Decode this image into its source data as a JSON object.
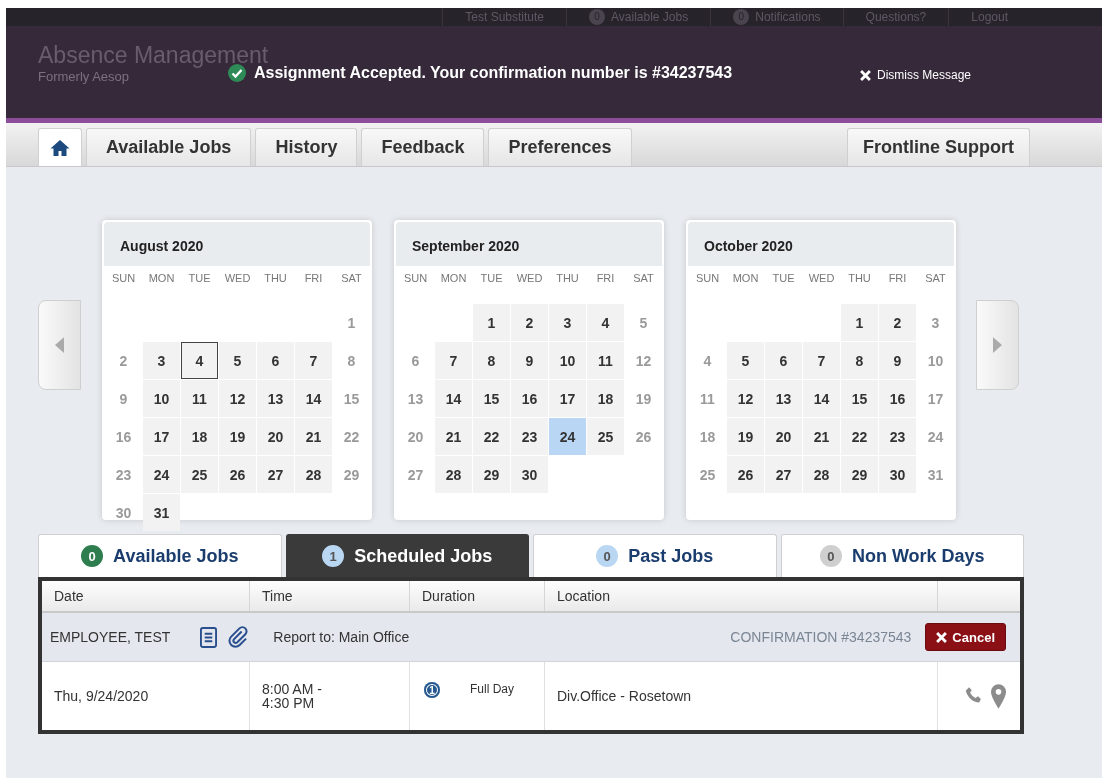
{
  "top_bar": {
    "user": "Test Substitute",
    "items": [
      {
        "count": "0",
        "label": "Available Jobs"
      },
      {
        "count": "0",
        "label": "Notifications"
      },
      {
        "label": "Questions?"
      },
      {
        "label": "Logout"
      }
    ]
  },
  "brand": {
    "title": "Absence Management",
    "subtitle": "Formerly Aesop"
  },
  "message": {
    "text": "Assignment Accepted. Your confirmation number is #34237543",
    "dismiss": "Dismiss Message"
  },
  "nav_tabs": [
    {
      "kind": "home",
      "selected": true
    },
    {
      "kind": "text",
      "label": "Available Jobs",
      "selected": false
    },
    {
      "kind": "text",
      "label": "History",
      "selected": false
    },
    {
      "kind": "text",
      "label": "Feedback",
      "selected": false
    },
    {
      "kind": "text",
      "label": "Preferences",
      "selected": false
    }
  ],
  "support_tab": {
    "label": "Frontline Support"
  },
  "calendars": [
    {
      "title": "August 2020",
      "weekdays": [
        "SUN",
        "MON",
        "TUE",
        "WED",
        "THU",
        "FRI",
        "SAT"
      ],
      "days": [
        {
          "kind": "blank"
        },
        {
          "kind": "blank"
        },
        {
          "kind": "blank"
        },
        {
          "kind": "blank"
        },
        {
          "kind": "blank"
        },
        {
          "kind": "blank"
        },
        {
          "d": "1",
          "kind": "off"
        },
        {
          "d": "2",
          "kind": "off"
        },
        {
          "d": "3",
          "kind": "work"
        },
        {
          "d": "4",
          "kind": "outlined"
        },
        {
          "d": "5",
          "kind": "work"
        },
        {
          "d": "6",
          "kind": "work"
        },
        {
          "d": "7",
          "kind": "work"
        },
        {
          "d": "8",
          "kind": "off"
        },
        {
          "d": "9",
          "kind": "off"
        },
        {
          "d": "10",
          "kind": "work"
        },
        {
          "d": "11",
          "kind": "work"
        },
        {
          "d": "12",
          "kind": "work"
        },
        {
          "d": "13",
          "kind": "work"
        },
        {
          "d": "14",
          "kind": "work"
        },
        {
          "d": "15",
          "kind": "off"
        },
        {
          "d": "16",
          "kind": "off"
        },
        {
          "d": "17",
          "kind": "work"
        },
        {
          "d": "18",
          "kind": "work"
        },
        {
          "d": "19",
          "kind": "work"
        },
        {
          "d": "20",
          "kind": "work"
        },
        {
          "d": "21",
          "kind": "work"
        },
        {
          "d": "22",
          "kind": "off"
        },
        {
          "d": "23",
          "kind": "off"
        },
        {
          "d": "24",
          "kind": "work"
        },
        {
          "d": "25",
          "kind": "work"
        },
        {
          "d": "26",
          "kind": "work"
        },
        {
          "d": "27",
          "kind": "work"
        },
        {
          "d": "28",
          "kind": "work"
        },
        {
          "d": "29",
          "kind": "off"
        },
        {
          "d": "30",
          "kind": "off"
        },
        {
          "d": "31",
          "kind": "work"
        }
      ]
    },
    {
      "title": "September 2020",
      "weekdays": [
        "SUN",
        "MON",
        "TUE",
        "WED",
        "THU",
        "FRI",
        "SAT"
      ],
      "days": [
        {
          "kind": "blank"
        },
        {
          "kind": "blank"
        },
        {
          "d": "1",
          "kind": "work"
        },
        {
          "d": "2",
          "kind": "work"
        },
        {
          "d": "3",
          "kind": "work"
        },
        {
          "d": "4",
          "kind": "work"
        },
        {
          "d": "5",
          "kind": "off"
        },
        {
          "d": "6",
          "kind": "off"
        },
        {
          "d": "7",
          "kind": "work"
        },
        {
          "d": "8",
          "kind": "work"
        },
        {
          "d": "9",
          "kind": "work"
        },
        {
          "d": "10",
          "kind": "work"
        },
        {
          "d": "11",
          "kind": "work"
        },
        {
          "d": "12",
          "kind": "off"
        },
        {
          "d": "13",
          "kind": "off"
        },
        {
          "d": "14",
          "kind": "work"
        },
        {
          "d": "15",
          "kind": "work"
        },
        {
          "d": "16",
          "kind": "work"
        },
        {
          "d": "17",
          "kind": "work"
        },
        {
          "d": "18",
          "kind": "work"
        },
        {
          "d": "19",
          "kind": "off"
        },
        {
          "d": "20",
          "kind": "off"
        },
        {
          "d": "21",
          "kind": "work"
        },
        {
          "d": "22",
          "kind": "work"
        },
        {
          "d": "23",
          "kind": "work"
        },
        {
          "d": "24",
          "kind": "booked"
        },
        {
          "d": "25",
          "kind": "work"
        },
        {
          "d": "26",
          "kind": "off"
        },
        {
          "d": "27",
          "kind": "off"
        },
        {
          "d": "28",
          "kind": "work"
        },
        {
          "d": "29",
          "kind": "work"
        },
        {
          "d": "30",
          "kind": "work"
        }
      ]
    },
    {
      "title": "October 2020",
      "weekdays": [
        "SUN",
        "MON",
        "TUE",
        "WED",
        "THU",
        "FRI",
        "SAT"
      ],
      "days": [
        {
          "kind": "blank"
        },
        {
          "kind": "blank"
        },
        {
          "kind": "blank"
        },
        {
          "kind": "blank"
        },
        {
          "d": "1",
          "kind": "work"
        },
        {
          "d": "2",
          "kind": "work"
        },
        {
          "d": "3",
          "kind": "off"
        },
        {
          "d": "4",
          "kind": "off"
        },
        {
          "d": "5",
          "kind": "work"
        },
        {
          "d": "6",
          "kind": "work"
        },
        {
          "d": "7",
          "kind": "work"
        },
        {
          "d": "8",
          "kind": "work"
        },
        {
          "d": "9",
          "kind": "work"
        },
        {
          "d": "10",
          "kind": "off"
        },
        {
          "d": "11",
          "kind": "off"
        },
        {
          "d": "12",
          "kind": "work"
        },
        {
          "d": "13",
          "kind": "work"
        },
        {
          "d": "14",
          "kind": "work"
        },
        {
          "d": "15",
          "kind": "work"
        },
        {
          "d": "16",
          "kind": "work"
        },
        {
          "d": "17",
          "kind": "off"
        },
        {
          "d": "18",
          "kind": "off"
        },
        {
          "d": "19",
          "kind": "work"
        },
        {
          "d": "20",
          "kind": "work"
        },
        {
          "d": "21",
          "kind": "work"
        },
        {
          "d": "22",
          "kind": "work"
        },
        {
          "d": "23",
          "kind": "work"
        },
        {
          "d": "24",
          "kind": "off"
        },
        {
          "d": "25",
          "kind": "off"
        },
        {
          "d": "26",
          "kind": "work"
        },
        {
          "d": "27",
          "kind": "work"
        },
        {
          "d": "28",
          "kind": "work"
        },
        {
          "d": "29",
          "kind": "work"
        },
        {
          "d": "30",
          "kind": "work"
        },
        {
          "d": "31",
          "kind": "off"
        }
      ]
    }
  ],
  "job_tabs": [
    {
      "count": "0",
      "label": "Available Jobs",
      "color": "#2e7d4f",
      "selected": false
    },
    {
      "count": "1",
      "label": "Scheduled Jobs",
      "color": "#b9d6f2",
      "selected": true
    },
    {
      "count": "0",
      "label": "Past Jobs",
      "color": "#b9d6f2",
      "selected": false
    },
    {
      "count": "0",
      "label": "Non Work Days",
      "color": "#cfcfcf",
      "selected": false
    }
  ],
  "table": {
    "columns": [
      "Date",
      "Time",
      "Duration",
      "Location"
    ],
    "group": {
      "employee": "EMPLOYEE, TEST",
      "report_to": "Report to: Main Office",
      "confirmation": "CONFIRMATION #34237543",
      "cancel": "Cancel"
    },
    "rows": [
      {
        "date": "Thu, 9/24/2020",
        "time": [
          "8:00 AM -",
          "4:30 PM"
        ],
        "duration_count": "1",
        "duration": "Full Day",
        "location": "Div.Office - Rosetown"
      }
    ]
  }
}
